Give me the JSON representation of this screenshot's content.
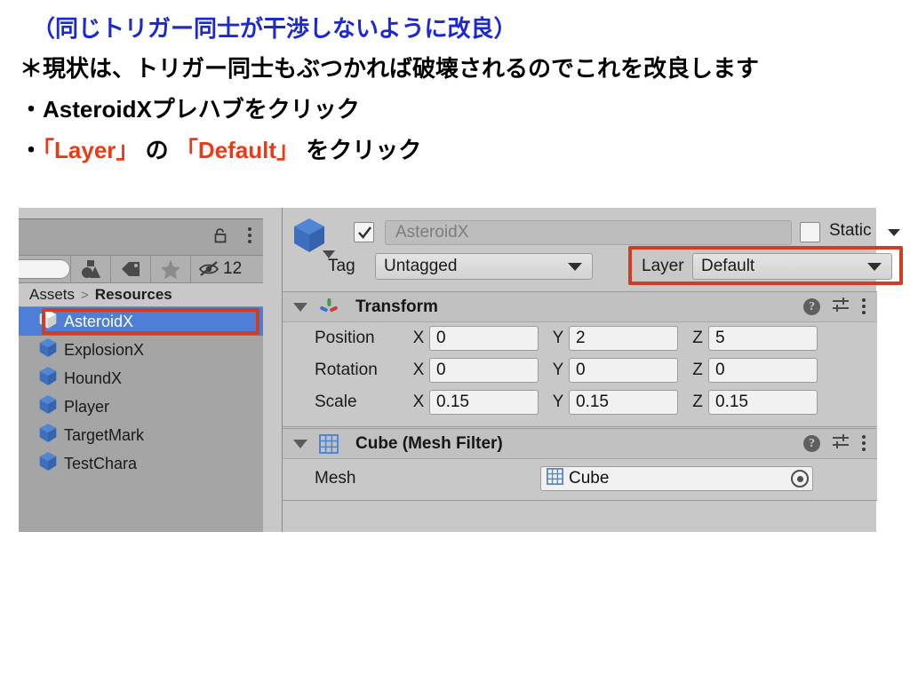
{
  "slide": {
    "line1": "（同じトリガー同士が干渉しないように改良）",
    "line2": "＊現状は、トリガー同士もぶつかれば破壊されるのでこれを改良します",
    "line3": "・AsteroidXプレハブをクリック",
    "line4_pre": "・",
    "line4_red1": "「Layer」",
    "line4_mid": " の ",
    "line4_red2": "「Default」",
    "line4_post": " をクリック",
    "colors": {
      "blue": "#1b2ad0",
      "black": "#000000",
      "red": "#ec3a16",
      "highlight_box": "#cf3d22",
      "selection_blue": "#4d7fd6"
    }
  },
  "project_panel": {
    "lock_icon": "lock-icon",
    "menu_icon": "kebab-menu-icon",
    "search_placeholder": "",
    "search_value": "",
    "toolbar_buttons": [
      {
        "icon": "shapes-filter-icon",
        "label": ""
      },
      {
        "icon": "tag-label-icon",
        "label": ""
      },
      {
        "icon": "star-favorite-icon",
        "label": ""
      },
      {
        "icon": "hidden-eye-icon",
        "label": "12"
      }
    ],
    "breadcrumb": {
      "root": "Assets",
      "separator": ">",
      "current": "Resources"
    },
    "assets": [
      {
        "name": "AsteroidX",
        "icon": "prefab-cube-icon",
        "selected": true
      },
      {
        "name": "ExplosionX",
        "icon": "prefab-cube-icon",
        "selected": false
      },
      {
        "name": "HoundX",
        "icon": "prefab-cube-icon",
        "selected": false
      },
      {
        "name": "Player",
        "icon": "prefab-cube-icon",
        "selected": false
      },
      {
        "name": "TargetMark",
        "icon": "prefab-cube-icon",
        "selected": false
      },
      {
        "name": "TestChara",
        "icon": "prefab-cube-icon",
        "selected": false
      }
    ]
  },
  "inspector": {
    "object_icon": "prefab-cube-icon",
    "enabled_checked": true,
    "name_value": "AsteroidX",
    "static_label": "Static",
    "static_checked": false,
    "tag_label": "Tag",
    "tag_value": "Untagged",
    "layer_label": "Layer",
    "layer_value": "Default",
    "components": [
      {
        "title": "Transform",
        "icon": "transform-axis-icon",
        "expanded": true,
        "rows": [
          {
            "label": "Position",
            "axes": [
              {
                "letter": "X",
                "value": "0"
              },
              {
                "letter": "Y",
                "value": "2"
              },
              {
                "letter": "Z",
                "value": "5"
              }
            ]
          },
          {
            "label": "Rotation",
            "axes": [
              {
                "letter": "X",
                "value": "0"
              },
              {
                "letter": "Y",
                "value": "0"
              },
              {
                "letter": "Z",
                "value": "0"
              }
            ]
          },
          {
            "label": "Scale",
            "axes": [
              {
                "letter": "X",
                "value": "0.15"
              },
              {
                "letter": "Y",
                "value": "0.15"
              },
              {
                "letter": "Z",
                "value": "0.15"
              }
            ]
          }
        ]
      },
      {
        "title": "Cube (Mesh Filter)",
        "icon": "mesh-grid-icon",
        "expanded": true,
        "mesh_label": "Mesh",
        "mesh_value": "Cube"
      }
    ],
    "header_icons": {
      "help": "?",
      "preset": "preset-sliders-icon",
      "menu": "kebab-menu-icon"
    }
  }
}
